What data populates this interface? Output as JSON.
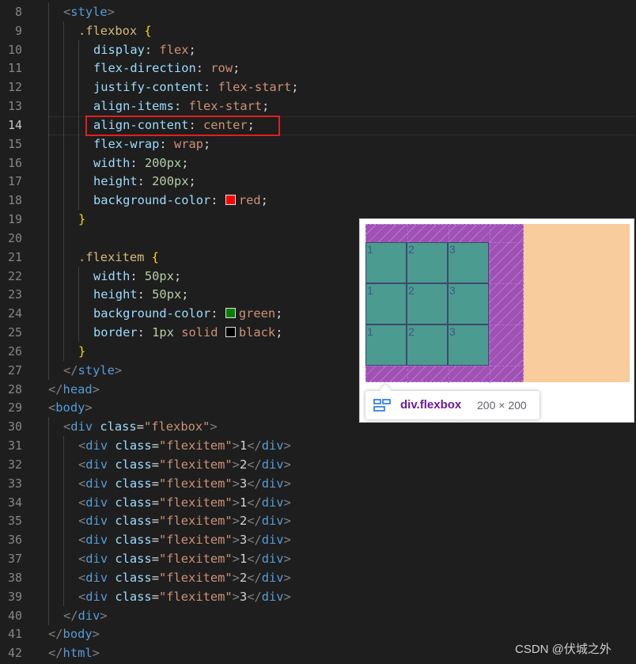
{
  "editor": {
    "lines": [
      {
        "no": "8",
        "indent": 1,
        "tokens": [
          {
            "t": "<",
            "c": "punct"
          },
          {
            "t": "style",
            "c": "tag"
          },
          {
            "t": ">",
            "c": "punct"
          }
        ]
      },
      {
        "no": "9",
        "indent": 2,
        "tokens": [
          {
            "t": ".flexbox ",
            "c": "sel"
          },
          {
            "t": "{",
            "c": "brace"
          }
        ]
      },
      {
        "no": "10",
        "indent": 3,
        "tokens": [
          {
            "t": "display",
            "c": "prop"
          },
          {
            "t": ": ",
            "c": "text"
          },
          {
            "t": "flex",
            "c": "val"
          },
          {
            "t": ";",
            "c": "text"
          }
        ]
      },
      {
        "no": "11",
        "indent": 3,
        "tokens": [
          {
            "t": "flex-direction",
            "c": "prop"
          },
          {
            "t": ": ",
            "c": "text"
          },
          {
            "t": "row",
            "c": "val"
          },
          {
            "t": ";",
            "c": "text"
          }
        ]
      },
      {
        "no": "12",
        "indent": 3,
        "tokens": [
          {
            "t": "justify-content",
            "c": "prop"
          },
          {
            "t": ": ",
            "c": "text"
          },
          {
            "t": "flex-start",
            "c": "val"
          },
          {
            "t": ";",
            "c": "text"
          }
        ]
      },
      {
        "no": "13",
        "indent": 3,
        "tokens": [
          {
            "t": "align-items",
            "c": "prop"
          },
          {
            "t": ": ",
            "c": "text"
          },
          {
            "t": "flex-start",
            "c": "val"
          },
          {
            "t": ";",
            "c": "text"
          }
        ]
      },
      {
        "no": "14",
        "indent": 3,
        "active": true,
        "tokens": [
          {
            "t": "align-content",
            "c": "prop"
          },
          {
            "t": ": ",
            "c": "text"
          },
          {
            "t": "center",
            "c": "val"
          },
          {
            "t": ";",
            "c": "text"
          }
        ]
      },
      {
        "no": "15",
        "indent": 3,
        "tokens": [
          {
            "t": "flex-wrap",
            "c": "prop"
          },
          {
            "t": ": ",
            "c": "text"
          },
          {
            "t": "wrap",
            "c": "val"
          },
          {
            "t": ";",
            "c": "text"
          }
        ]
      },
      {
        "no": "16",
        "indent": 3,
        "tokens": [
          {
            "t": "width",
            "c": "prop"
          },
          {
            "t": ": ",
            "c": "text"
          },
          {
            "t": "200px",
            "c": "num"
          },
          {
            "t": ";",
            "c": "text"
          }
        ]
      },
      {
        "no": "17",
        "indent": 3,
        "tokens": [
          {
            "t": "height",
            "c": "prop"
          },
          {
            "t": ": ",
            "c": "text"
          },
          {
            "t": "200px",
            "c": "num"
          },
          {
            "t": ";",
            "c": "text"
          }
        ]
      },
      {
        "no": "18",
        "indent": 3,
        "tokens": [
          {
            "t": "background-color",
            "c": "prop"
          },
          {
            "t": ": ",
            "c": "text"
          },
          {
            "t": "",
            "c": "swatch",
            "color": "#ff0000"
          },
          {
            "t": "red",
            "c": "val"
          },
          {
            "t": ";",
            "c": "text"
          }
        ]
      },
      {
        "no": "19",
        "indent": 2,
        "tokens": [
          {
            "t": "}",
            "c": "brace"
          }
        ]
      },
      {
        "no": "20",
        "indent": 2,
        "tokens": []
      },
      {
        "no": "21",
        "indent": 2,
        "tokens": [
          {
            "t": ".flexitem ",
            "c": "sel"
          },
          {
            "t": "{",
            "c": "brace"
          }
        ]
      },
      {
        "no": "22",
        "indent": 3,
        "tokens": [
          {
            "t": "width",
            "c": "prop"
          },
          {
            "t": ": ",
            "c": "text"
          },
          {
            "t": "50px",
            "c": "num"
          },
          {
            "t": ";",
            "c": "text"
          }
        ]
      },
      {
        "no": "23",
        "indent": 3,
        "tokens": [
          {
            "t": "height",
            "c": "prop"
          },
          {
            "t": ": ",
            "c": "text"
          },
          {
            "t": "50px",
            "c": "num"
          },
          {
            "t": ";",
            "c": "text"
          }
        ]
      },
      {
        "no": "24",
        "indent": 3,
        "tokens": [
          {
            "t": "background-color",
            "c": "prop"
          },
          {
            "t": ": ",
            "c": "text"
          },
          {
            "t": "",
            "c": "swatch",
            "color": "#008000"
          },
          {
            "t": "green",
            "c": "val"
          },
          {
            "t": ";",
            "c": "text"
          }
        ]
      },
      {
        "no": "25",
        "indent": 3,
        "tokens": [
          {
            "t": "border",
            "c": "prop"
          },
          {
            "t": ": ",
            "c": "text"
          },
          {
            "t": "1px",
            "c": "num"
          },
          {
            "t": " solid ",
            "c": "val"
          },
          {
            "t": "",
            "c": "swatch",
            "color": "#000000"
          },
          {
            "t": "black",
            "c": "val"
          },
          {
            "t": ";",
            "c": "text"
          }
        ]
      },
      {
        "no": "26",
        "indent": 2,
        "tokens": [
          {
            "t": "}",
            "c": "brace"
          }
        ]
      },
      {
        "no": "27",
        "indent": 1,
        "tokens": [
          {
            "t": "</",
            "c": "punct"
          },
          {
            "t": "style",
            "c": "tag"
          },
          {
            "t": ">",
            "c": "punct"
          }
        ]
      },
      {
        "no": "28",
        "indent": 0,
        "tokens": [
          {
            "t": "</",
            "c": "punct"
          },
          {
            "t": "head",
            "c": "tag"
          },
          {
            "t": ">",
            "c": "punct"
          }
        ]
      },
      {
        "no": "29",
        "indent": 0,
        "tokens": [
          {
            "t": "<",
            "c": "punct"
          },
          {
            "t": "body",
            "c": "tag"
          },
          {
            "t": ">",
            "c": "punct"
          }
        ]
      },
      {
        "no": "30",
        "indent": 1,
        "tokens": [
          {
            "t": "<",
            "c": "punct"
          },
          {
            "t": "div",
            "c": "tag"
          },
          {
            "t": " class",
            "c": "attr"
          },
          {
            "t": "=",
            "c": "text"
          },
          {
            "t": "\"flexbox\"",
            "c": "str"
          },
          {
            "t": ">",
            "c": "punct"
          }
        ]
      },
      {
        "no": "31",
        "indent": 2,
        "tokens": [
          {
            "t": "<",
            "c": "punct"
          },
          {
            "t": "div",
            "c": "tag"
          },
          {
            "t": " class",
            "c": "attr"
          },
          {
            "t": "=",
            "c": "text"
          },
          {
            "t": "\"flexitem\"",
            "c": "str"
          },
          {
            "t": ">",
            "c": "punct"
          },
          {
            "t": "1",
            "c": "text"
          },
          {
            "t": "</",
            "c": "punct"
          },
          {
            "t": "div",
            "c": "tag"
          },
          {
            "t": ">",
            "c": "punct"
          }
        ]
      },
      {
        "no": "32",
        "indent": 2,
        "tokens": [
          {
            "t": "<",
            "c": "punct"
          },
          {
            "t": "div",
            "c": "tag"
          },
          {
            "t": " class",
            "c": "attr"
          },
          {
            "t": "=",
            "c": "text"
          },
          {
            "t": "\"flexitem\"",
            "c": "str"
          },
          {
            "t": ">",
            "c": "punct"
          },
          {
            "t": "2",
            "c": "text"
          },
          {
            "t": "</",
            "c": "punct"
          },
          {
            "t": "div",
            "c": "tag"
          },
          {
            "t": ">",
            "c": "punct"
          }
        ]
      },
      {
        "no": "33",
        "indent": 2,
        "tokens": [
          {
            "t": "<",
            "c": "punct"
          },
          {
            "t": "div",
            "c": "tag"
          },
          {
            "t": " class",
            "c": "attr"
          },
          {
            "t": "=",
            "c": "text"
          },
          {
            "t": "\"flexitem\"",
            "c": "str"
          },
          {
            "t": ">",
            "c": "punct"
          },
          {
            "t": "3",
            "c": "text"
          },
          {
            "t": "</",
            "c": "punct"
          },
          {
            "t": "div",
            "c": "tag"
          },
          {
            "t": ">",
            "c": "punct"
          }
        ]
      },
      {
        "no": "34",
        "indent": 2,
        "tokens": [
          {
            "t": "<",
            "c": "punct"
          },
          {
            "t": "div",
            "c": "tag"
          },
          {
            "t": " class",
            "c": "attr"
          },
          {
            "t": "=",
            "c": "text"
          },
          {
            "t": "\"flexitem\"",
            "c": "str"
          },
          {
            "t": ">",
            "c": "punct"
          },
          {
            "t": "1",
            "c": "text"
          },
          {
            "t": "</",
            "c": "punct"
          },
          {
            "t": "div",
            "c": "tag"
          },
          {
            "t": ">",
            "c": "punct"
          }
        ]
      },
      {
        "no": "35",
        "indent": 2,
        "tokens": [
          {
            "t": "<",
            "c": "punct"
          },
          {
            "t": "div",
            "c": "tag"
          },
          {
            "t": " class",
            "c": "attr"
          },
          {
            "t": "=",
            "c": "text"
          },
          {
            "t": "\"flexitem\"",
            "c": "str"
          },
          {
            "t": ">",
            "c": "punct"
          },
          {
            "t": "2",
            "c": "text"
          },
          {
            "t": "</",
            "c": "punct"
          },
          {
            "t": "div",
            "c": "tag"
          },
          {
            "t": ">",
            "c": "punct"
          }
        ]
      },
      {
        "no": "36",
        "indent": 2,
        "tokens": [
          {
            "t": "<",
            "c": "punct"
          },
          {
            "t": "div",
            "c": "tag"
          },
          {
            "t": " class",
            "c": "attr"
          },
          {
            "t": "=",
            "c": "text"
          },
          {
            "t": "\"flexitem\"",
            "c": "str"
          },
          {
            "t": ">",
            "c": "punct"
          },
          {
            "t": "3",
            "c": "text"
          },
          {
            "t": "</",
            "c": "punct"
          },
          {
            "t": "div",
            "c": "tag"
          },
          {
            "t": ">",
            "c": "punct"
          }
        ]
      },
      {
        "no": "37",
        "indent": 2,
        "tokens": [
          {
            "t": "<",
            "c": "punct"
          },
          {
            "t": "div",
            "c": "tag"
          },
          {
            "t": " class",
            "c": "attr"
          },
          {
            "t": "=",
            "c": "text"
          },
          {
            "t": "\"flexitem\"",
            "c": "str"
          },
          {
            "t": ">",
            "c": "punct"
          },
          {
            "t": "1",
            "c": "text"
          },
          {
            "t": "</",
            "c": "punct"
          },
          {
            "t": "div",
            "c": "tag"
          },
          {
            "t": ">",
            "c": "punct"
          }
        ]
      },
      {
        "no": "38",
        "indent": 2,
        "tokens": [
          {
            "t": "<",
            "c": "punct"
          },
          {
            "t": "div",
            "c": "tag"
          },
          {
            "t": " class",
            "c": "attr"
          },
          {
            "t": "=",
            "c": "text"
          },
          {
            "t": "\"flexitem\"",
            "c": "str"
          },
          {
            "t": ">",
            "c": "punct"
          },
          {
            "t": "2",
            "c": "text"
          },
          {
            "t": "</",
            "c": "punct"
          },
          {
            "t": "div",
            "c": "tag"
          },
          {
            "t": ">",
            "c": "punct"
          }
        ]
      },
      {
        "no": "39",
        "indent": 2,
        "tokens": [
          {
            "t": "<",
            "c": "punct"
          },
          {
            "t": "div",
            "c": "tag"
          },
          {
            "t": " class",
            "c": "attr"
          },
          {
            "t": "=",
            "c": "text"
          },
          {
            "t": "\"flexitem\"",
            "c": "str"
          },
          {
            "t": ">",
            "c": "punct"
          },
          {
            "t": "3",
            "c": "text"
          },
          {
            "t": "</",
            "c": "punct"
          },
          {
            "t": "div",
            "c": "tag"
          },
          {
            "t": ">",
            "c": "punct"
          }
        ]
      },
      {
        "no": "40",
        "indent": 1,
        "tokens": [
          {
            "t": "</",
            "c": "punct"
          },
          {
            "t": "div",
            "c": "tag"
          },
          {
            "t": ">",
            "c": "punct"
          }
        ]
      },
      {
        "no": "41",
        "indent": 0,
        "tokens": [
          {
            "t": "</",
            "c": "punct"
          },
          {
            "t": "body",
            "c": "tag"
          },
          {
            "t": ">",
            "c": "punct"
          }
        ]
      },
      {
        "no": "42",
        "indent": 0,
        "tokens": [
          {
            "t": "</",
            "c": "punct"
          },
          {
            "t": "html",
            "c": "tag"
          },
          {
            "t": ">",
            "c": "punct"
          }
        ]
      }
    ]
  },
  "preview": {
    "items": [
      "1",
      "2",
      "3",
      "1",
      "2",
      "3",
      "1",
      "2",
      "3"
    ],
    "colors": {
      "flexbox_overlay": "#9f52b4",
      "margin": "#f9cc9d",
      "item": "#4b9b91"
    }
  },
  "tooltip": {
    "icon": "flex-container-icon",
    "element": "div.flexbox",
    "size": "200 × 200"
  },
  "watermark": "CSDN @伏城之外"
}
